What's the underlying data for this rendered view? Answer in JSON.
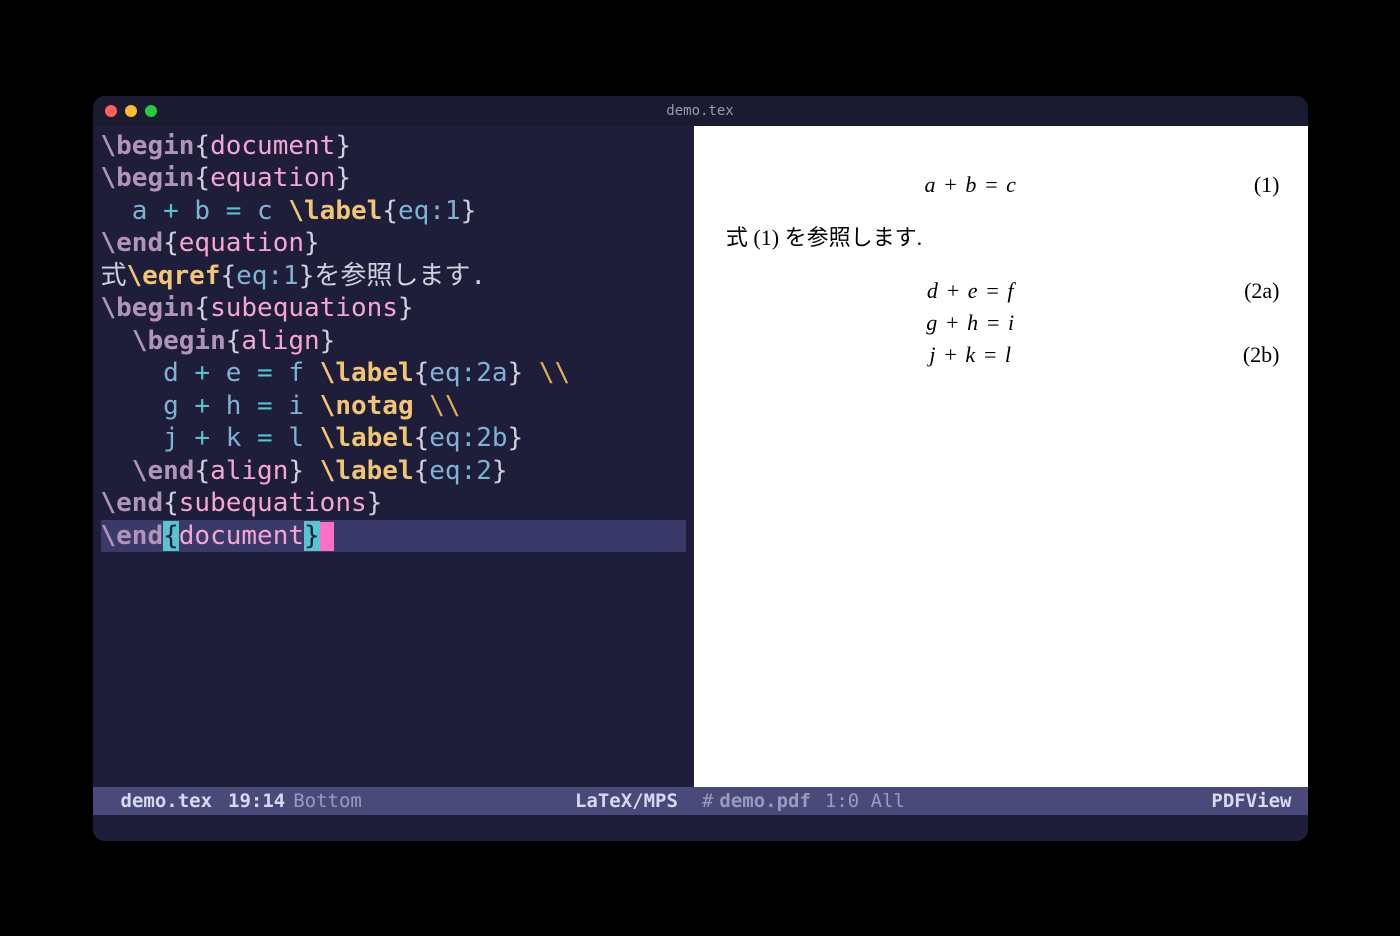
{
  "window": {
    "title": "demo.tex"
  },
  "editor": {
    "lines": [
      {
        "tokens": [
          {
            "t": "\\begin",
            "c": "kw"
          },
          {
            "t": "{",
            "c": "brace"
          },
          {
            "t": "document",
            "c": "env"
          },
          {
            "t": "}",
            "c": "brace"
          }
        ]
      },
      {
        "tokens": [
          {
            "t": "\\begin",
            "c": "kw"
          },
          {
            "t": "{",
            "c": "brace"
          },
          {
            "t": "equation",
            "c": "env"
          },
          {
            "t": "}",
            "c": "brace"
          }
        ]
      },
      {
        "tokens": [
          {
            "t": "  a ",
            "c": "arg"
          },
          {
            "t": "+",
            "c": "op"
          },
          {
            "t": " b ",
            "c": "arg"
          },
          {
            "t": "=",
            "c": "op"
          },
          {
            "t": " c ",
            "c": "arg"
          },
          {
            "t": "\\label",
            "c": "cmd"
          },
          {
            "t": "{",
            "c": "brace"
          },
          {
            "t": "eq:1",
            "c": "arg"
          },
          {
            "t": "}",
            "c": "brace"
          }
        ]
      },
      {
        "tokens": [
          {
            "t": "\\end",
            "c": "kw"
          },
          {
            "t": "{",
            "c": "brace"
          },
          {
            "t": "equation",
            "c": "env"
          },
          {
            "t": "}",
            "c": "brace"
          }
        ]
      },
      {
        "tokens": [
          {
            "t": "式",
            "c": "txt"
          },
          {
            "t": "\\eqref",
            "c": "cmd"
          },
          {
            "t": "{",
            "c": "brace"
          },
          {
            "t": "eq:1",
            "c": "arg"
          },
          {
            "t": "}",
            "c": "brace"
          },
          {
            "t": "を参照します.",
            "c": "txt"
          }
        ]
      },
      {
        "tokens": [
          {
            "t": "\\begin",
            "c": "kw"
          },
          {
            "t": "{",
            "c": "brace"
          },
          {
            "t": "subequations",
            "c": "env"
          },
          {
            "t": "}",
            "c": "brace"
          }
        ]
      },
      {
        "tokens": [
          {
            "t": "  ",
            "c": "txt"
          },
          {
            "t": "\\begin",
            "c": "kw"
          },
          {
            "t": "{",
            "c": "brace"
          },
          {
            "t": "align",
            "c": "env"
          },
          {
            "t": "}",
            "c": "brace"
          }
        ]
      },
      {
        "tokens": [
          {
            "t": "    d ",
            "c": "arg"
          },
          {
            "t": "+",
            "c": "op"
          },
          {
            "t": " e ",
            "c": "arg"
          },
          {
            "t": "=",
            "c": "op"
          },
          {
            "t": " f ",
            "c": "arg"
          },
          {
            "t": "\\label",
            "c": "cmd"
          },
          {
            "t": "{",
            "c": "brace"
          },
          {
            "t": "eq:2a",
            "c": "arg"
          },
          {
            "t": "} ",
            "c": "brace"
          },
          {
            "t": "\\\\",
            "c": "slash"
          }
        ]
      },
      {
        "tokens": [
          {
            "t": "    g ",
            "c": "arg"
          },
          {
            "t": "+",
            "c": "op"
          },
          {
            "t": " h ",
            "c": "arg"
          },
          {
            "t": "=",
            "c": "op"
          },
          {
            "t": " i ",
            "c": "arg"
          },
          {
            "t": "\\notag",
            "c": "cmd"
          },
          {
            "t": " ",
            "c": "txt"
          },
          {
            "t": "\\\\",
            "c": "slash"
          }
        ]
      },
      {
        "tokens": [
          {
            "t": "    j ",
            "c": "arg"
          },
          {
            "t": "+",
            "c": "op"
          },
          {
            "t": " k ",
            "c": "arg"
          },
          {
            "t": "=",
            "c": "op"
          },
          {
            "t": " l ",
            "c": "arg"
          },
          {
            "t": "\\label",
            "c": "cmd"
          },
          {
            "t": "{",
            "c": "brace"
          },
          {
            "t": "eq:2b",
            "c": "arg"
          },
          {
            "t": "}",
            "c": "brace"
          }
        ]
      },
      {
        "tokens": [
          {
            "t": "  ",
            "c": "txt"
          },
          {
            "t": "\\end",
            "c": "kw"
          },
          {
            "t": "{",
            "c": "brace"
          },
          {
            "t": "align",
            "c": "env"
          },
          {
            "t": "} ",
            "c": "brace"
          },
          {
            "t": "\\label",
            "c": "cmd"
          },
          {
            "t": "{",
            "c": "brace"
          },
          {
            "t": "eq:2",
            "c": "arg"
          },
          {
            "t": "}",
            "c": "brace"
          }
        ]
      },
      {
        "tokens": [
          {
            "t": "\\end",
            "c": "kw"
          },
          {
            "t": "{",
            "c": "brace"
          },
          {
            "t": "subequations",
            "c": "env"
          },
          {
            "t": "}",
            "c": "brace"
          }
        ]
      },
      {
        "hl": true,
        "tokens": [
          {
            "t": "\\end",
            "c": "kw"
          },
          {
            "t": "{",
            "c": "hl-brace"
          },
          {
            "t": "document",
            "c": "env"
          },
          {
            "t": "}",
            "c": "hl-brace"
          }
        ],
        "cursor": true
      }
    ]
  },
  "preview": {
    "eq1": {
      "body": "a + b = c",
      "num": "(1)"
    },
    "prose": "式 (1) を参照します.",
    "sub": [
      {
        "body": "d + e = f",
        "num": "(2a)"
      },
      {
        "body": "g + h = i",
        "num": ""
      },
      {
        "body": "j + k = l",
        "num": "(2b)"
      }
    ]
  },
  "statusbar_left": {
    "file": "demo.tex",
    "pos": "19:14",
    "where": "Bottom",
    "mode": "LaTeX/MPS"
  },
  "statusbar_right": {
    "prefix": "#",
    "file": "demo.pdf",
    "pos": "1:0 All",
    "mode": "PDFView"
  }
}
